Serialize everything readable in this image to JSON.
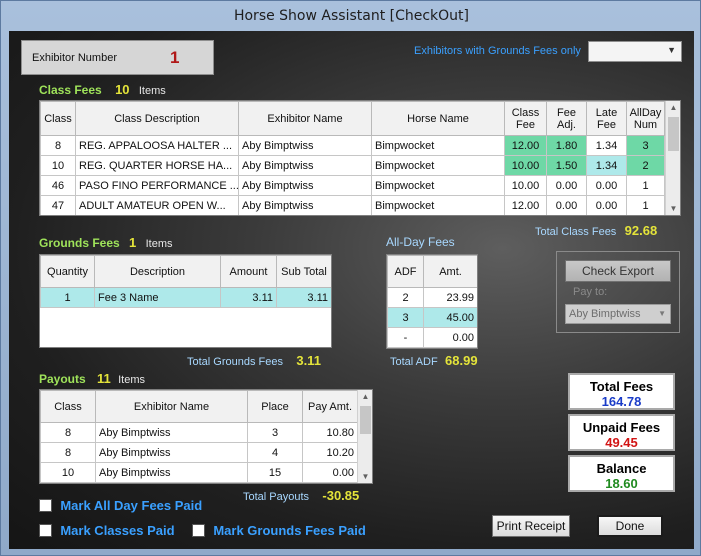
{
  "window": {
    "title": "Horse Show Assistant  [CheckOut]"
  },
  "exhibitor": {
    "label": "Exhibitor Number",
    "number": "1"
  },
  "filter": {
    "label": "Exhibitors with Grounds Fees only",
    "selected": ""
  },
  "class_fees": {
    "title": "Class Fees",
    "count": "10",
    "items_label": "Items",
    "columns": [
      "Class",
      "Class Description",
      "Exhibitor Name",
      "Horse Name",
      "Class Fee",
      "Fee Adj.",
      "Late Fee",
      "AllDay Num"
    ],
    "rows": [
      {
        "class": "8",
        "description": "REG. APPALOOSA HALTER ...",
        "exhibitor": "Aby Bimptwiss",
        "horse": "Bimpwocket",
        "class_fee": "12.00",
        "fee_adj": "1.80",
        "late_fee": "1.34",
        "allday": "3"
      },
      {
        "class": "10",
        "description": "REG. QUARTER HORSE HA...",
        "exhibitor": "Aby Bimptwiss",
        "horse": "Bimpwocket",
        "class_fee": "10.00",
        "fee_adj": "1.50",
        "late_fee": "1.34",
        "allday": "2"
      },
      {
        "class": "46",
        "description": "PASO FINO PERFORMANCE ...",
        "exhibitor": "Aby Bimptwiss",
        "horse": "Bimpwocket",
        "class_fee": "10.00",
        "fee_adj": "0.00",
        "late_fee": "0.00",
        "allday": "1"
      },
      {
        "class": "47",
        "description": "ADULT AMATEUR OPEN W...",
        "exhibitor": "Aby Bimptwiss",
        "horse": "Bimpwocket",
        "class_fee": "12.00",
        "fee_adj": "0.00",
        "late_fee": "0.00",
        "allday": "1"
      }
    ],
    "total_label": "Total Class Fees",
    "total": "92.68"
  },
  "grounds_fees": {
    "title": "Grounds Fees",
    "count": "1",
    "items_label": "Items",
    "columns": [
      "Quantity",
      "Description",
      "Amount",
      "Sub Total"
    ],
    "rows": [
      {
        "quantity": "1",
        "description": "Fee 3 Name",
        "amount": "3.11",
        "subtotal": "3.11"
      }
    ],
    "total_label": "Total Grounds Fees",
    "total": "3.11"
  },
  "allday_fees": {
    "title": "All-Day Fees",
    "columns": [
      "ADF",
      "Amt."
    ],
    "rows": [
      {
        "adf": "2",
        "amt": "23.99"
      },
      {
        "adf": "3",
        "amt": "45.00"
      },
      {
        "adf": "-",
        "amt": "0.00"
      }
    ],
    "total_label": "Total ADF",
    "total": "68.99"
  },
  "check_export": {
    "button": "Check Export",
    "pay_to_label": "Pay to:",
    "pay_to_value": "Aby Bimptwiss"
  },
  "payouts": {
    "title": "Payouts",
    "count": "11",
    "items_label": "Items",
    "columns": [
      "Class",
      "Exhibitor Name",
      "Place",
      "Pay Amt."
    ],
    "rows": [
      {
        "class": "8",
        "exhibitor": "Aby Bimptwiss",
        "place": "3",
        "pay": "10.80"
      },
      {
        "class": "8",
        "exhibitor": "Aby Bimptwiss",
        "place": "4",
        "pay": "10.20"
      },
      {
        "class": "10",
        "exhibitor": "Aby Bimptwiss",
        "place": "15",
        "pay": "0.00"
      }
    ],
    "total_label": "Total Payouts",
    "total": "-30.85"
  },
  "summary": {
    "total_fees_label": "Total Fees",
    "total_fees": "164.78",
    "unpaid_fees_label": "Unpaid Fees",
    "unpaid_fees": "49.45",
    "balance_label": "Balance",
    "balance": "18.60"
  },
  "checkboxes": {
    "all_day": "Mark All Day Fees Paid",
    "classes": "Mark Classes Paid",
    "grounds": "Mark Grounds Fees Paid"
  },
  "buttons": {
    "print_receipt": "Print Receipt",
    "done": "Done"
  },
  "colors": {
    "count_yellow": "#e4e43a",
    "heading_green": "#9fe35a",
    "label_blue": "#a8d8ff",
    "checkbox_blue": "#3aa0ff",
    "teal_cell": "#6ed8a6",
    "cyan_cell": "#aee9ea",
    "total_fees_blue": "#1a3cc8",
    "unpaid_red": "#d21414",
    "balance_green": "#1f8a1f"
  }
}
